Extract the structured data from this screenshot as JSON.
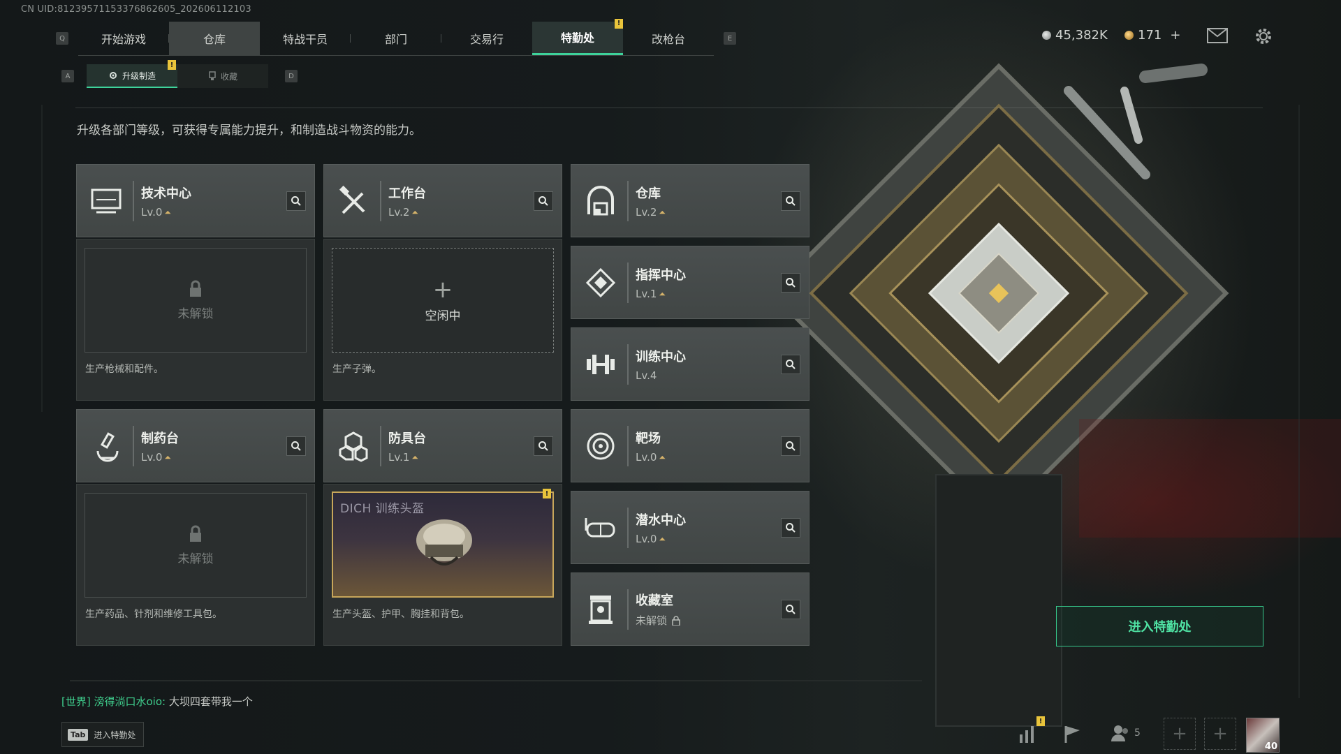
{
  "uid": "CN UID:8123957115337686260​5_202606112103",
  "nav": {
    "left_key": "Q",
    "right_key": "E",
    "tabs": [
      {
        "label": "开始游戏"
      },
      {
        "label": "仓库"
      },
      {
        "label": "特战干员"
      },
      {
        "label": "部门"
      },
      {
        "label": "交易行"
      },
      {
        "label": "特勤处"
      },
      {
        "label": "改枪台"
      }
    ],
    "active_tab": "特勤处",
    "badge": "!"
  },
  "subnav": {
    "left_key": "A",
    "right_key": "D",
    "tabs": [
      {
        "label": "升级制造"
      },
      {
        "label": "收藏"
      }
    ],
    "badge": "!"
  },
  "currency": {
    "silver": "45,382K",
    "gold": "171",
    "gold_add": "+"
  },
  "description": "升级各部门等级，可获得专属能力提升，和制造战斗物资的能力。",
  "departments": {
    "tech": {
      "name": "技术中心",
      "level": "Lv.0",
      "slot_status": "未解锁",
      "desc": "生产枪械和配件。"
    },
    "workbench": {
      "name": "工作台",
      "level": "Lv.2",
      "slot_plus": "+",
      "slot_status": "空闲中",
      "desc": "生产子弹。"
    },
    "warehouse": {
      "name": "仓库",
      "level": "Lv.2"
    },
    "command": {
      "name": "指挥中心",
      "level": "Lv.1"
    },
    "training": {
      "name": "训练中心",
      "level": "Lv.4"
    },
    "pharmacy": {
      "name": "制药台",
      "level": "Lv.0",
      "slot_status": "未解锁",
      "desc": "生产药品、针剂和维修工具包。"
    },
    "armor": {
      "name": "防具台",
      "level": "Lv.1",
      "slot_item": "DICH 训练头盔",
      "desc": "生产头盔、护甲、胸挂和背包。"
    },
    "range": {
      "name": "靶场",
      "level": "Lv.0"
    },
    "diving": {
      "name": "潜水中心",
      "level": "Lv.0"
    },
    "collection": {
      "name": "收藏室",
      "level": "未解锁"
    }
  },
  "enter_button": "进入特勤处",
  "chat": {
    "channel": "[世界]",
    "sender": "滂得淌口水oio:",
    "message": "大坝四套带我一个"
  },
  "tab_hint": {
    "key": "Tab",
    "label": "进入特勤处"
  },
  "bottom": {
    "friends_count": "5",
    "player_level": "40",
    "badge": "!"
  },
  "colors": {
    "accent": "#3ed39b",
    "badge": "#e9c43b",
    "upgrade": "#d6b36a"
  }
}
